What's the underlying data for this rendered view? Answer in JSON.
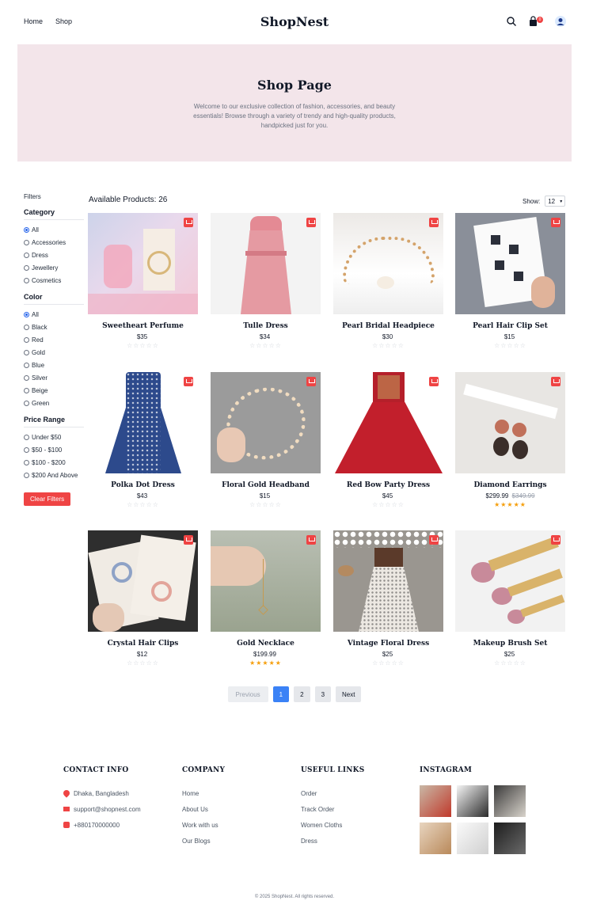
{
  "header": {
    "nav": [
      "Home",
      "Shop"
    ],
    "brand": "ShopNest",
    "cart_count": "0"
  },
  "hero": {
    "title": "Shop Page",
    "text": "Welcome to our exclusive collection of fashion, accessories, and beauty essentials! Browse through a variety of trendy and high-quality products, handpicked just for you."
  },
  "sidebar": {
    "title": "Filters",
    "category_title": "Category",
    "categories": [
      "All",
      "Accessories",
      "Dress",
      "Jewellery",
      "Cosmetics"
    ],
    "color_title": "Color",
    "colors": [
      "All",
      "Black",
      "Red",
      "Gold",
      "Blue",
      "Silver",
      "Beige",
      "Green"
    ],
    "price_title": "Price Range",
    "prices": [
      "Under $50",
      "$50 - $100",
      "$100 - $200",
      "$200 And Above"
    ],
    "clear": "Clear Filters"
  },
  "toolbar": {
    "count": "Available Products: 26",
    "show_label": "Show:",
    "show_value": "12"
  },
  "products": [
    {
      "name": "Sweetheart Perfume",
      "price": "$35",
      "old": "",
      "stars": "☆☆☆☆☆",
      "rated": false
    },
    {
      "name": "Tulle Dress",
      "price": "$34",
      "old": "",
      "stars": "☆☆☆☆☆",
      "rated": false
    },
    {
      "name": "Pearl Bridal Headpiece",
      "price": "$30",
      "old": "",
      "stars": "☆☆☆☆☆",
      "rated": false
    },
    {
      "name": "Pearl Hair Clip Set",
      "price": "$15",
      "old": "",
      "stars": "☆☆☆☆☆",
      "rated": false
    },
    {
      "name": "Polka Dot Dress",
      "price": "$43",
      "old": "",
      "stars": "☆☆☆☆☆",
      "rated": false
    },
    {
      "name": "Floral Gold Headband",
      "price": "$15",
      "old": "",
      "stars": "☆☆☆☆☆",
      "rated": false
    },
    {
      "name": "Red Bow Party Dress",
      "price": "$45",
      "old": "",
      "stars": "☆☆☆☆☆",
      "rated": false
    },
    {
      "name": "Diamond Earrings",
      "price": "$299.99",
      "old": "$349.99",
      "stars": "★★★★★",
      "rated": true
    },
    {
      "name": "Crystal Hair Clips",
      "price": "$12",
      "old": "",
      "stars": "☆☆☆☆☆",
      "rated": false
    },
    {
      "name": "Gold Necklace",
      "price": "$199.99",
      "old": "",
      "stars": "★★★★★",
      "rated": true
    },
    {
      "name": "Vintage Floral Dress",
      "price": "$25",
      "old": "",
      "stars": "☆☆☆☆☆",
      "rated": false
    },
    {
      "name": "Makeup Brush Set",
      "price": "$25",
      "old": "",
      "stars": "☆☆☆☆☆",
      "rated": false
    }
  ],
  "pagination": {
    "prev": "Previous",
    "pages": [
      "1",
      "2",
      "3"
    ],
    "active": "1",
    "next": "Next"
  },
  "footer": {
    "contact_title": "CONTACT INFO",
    "contact": [
      "Dhaka, Bangladesh",
      "support@shopnest.com",
      "+880170000000"
    ],
    "company_title": "COMPANY",
    "company": [
      "Home",
      "About Us",
      "Work with us",
      "Our Blogs"
    ],
    "links_title": "USEFUL LINKS",
    "links": [
      "Order",
      "Track Order",
      "Women Cloths",
      "Dress"
    ],
    "insta_title": "INSTAGRAM",
    "copyright": "© 2025 ShopNest. All rights reserved."
  },
  "colors": {
    "accent": "#ef4444",
    "hero_bg": "#f3e5ea",
    "active_page": "#3b82f6",
    "star": "#f59e0b"
  }
}
